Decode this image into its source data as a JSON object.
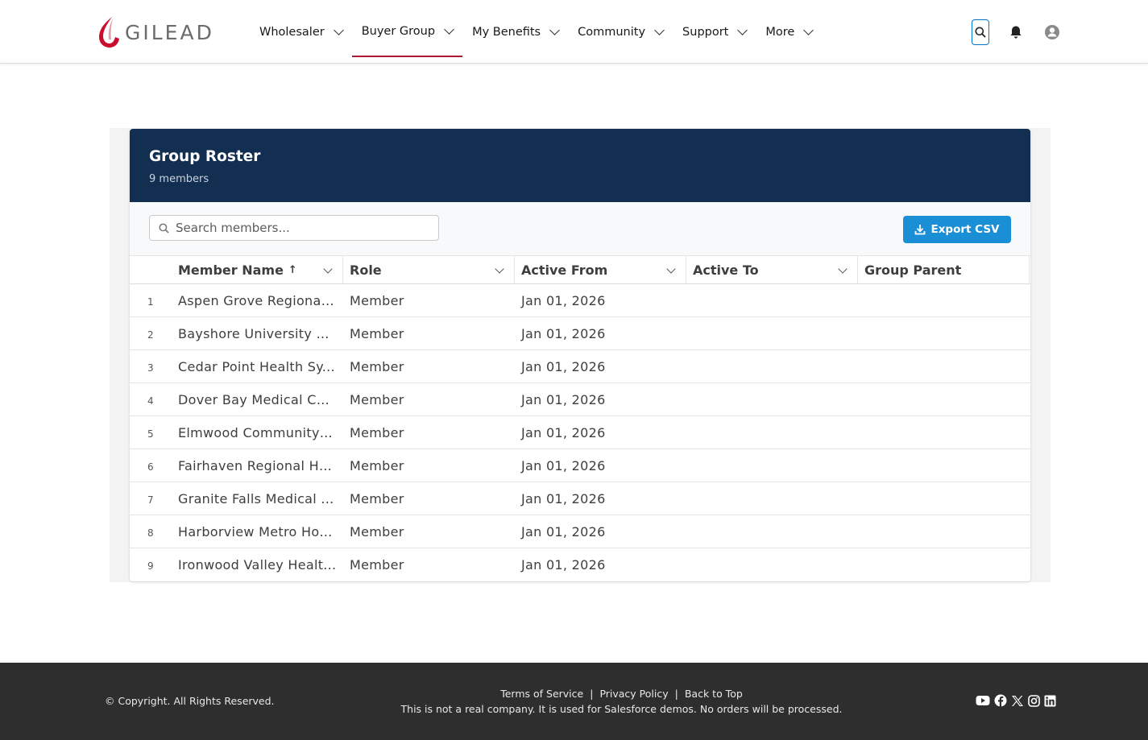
{
  "brand": {
    "name": "GILEAD",
    "accent": "#b0162d"
  },
  "nav": {
    "items": [
      {
        "label": "Wholesaler"
      },
      {
        "label": "Buyer Group"
      },
      {
        "label": "My Benefits"
      },
      {
        "label": "Community"
      },
      {
        "label": "Support"
      },
      {
        "label": "More"
      }
    ],
    "active": "Buyer Group"
  },
  "header_icons": [
    "search-icon",
    "bell-icon",
    "user-avatar-icon"
  ],
  "roster": {
    "title": "Group Roster",
    "subtitle": "9 members",
    "search_placeholder": "Search members...",
    "export_label": "Export CSV",
    "columns": {
      "name": "Member Name",
      "name_sort": "↑",
      "role": "Role",
      "from": "Active From",
      "to": "Active To",
      "parent": "Group Parent"
    },
    "rows": [
      {
        "n": "1",
        "name": "Aspen Grove Regional...",
        "role": "Member",
        "from": "Jan 01, 2026",
        "to": "",
        "parent": ""
      },
      {
        "n": "2",
        "name": "Bayshore University H...",
        "role": "Member",
        "from": "Jan 01, 2026",
        "to": "",
        "parent": ""
      },
      {
        "n": "3",
        "name": "Cedar Point Health Sy...",
        "role": "Member",
        "from": "Jan 01, 2026",
        "to": "",
        "parent": ""
      },
      {
        "n": "4",
        "name": "Dover Bay Medical Ce...",
        "role": "Member",
        "from": "Jan 01, 2026",
        "to": "",
        "parent": ""
      },
      {
        "n": "5",
        "name": "Elmwood Community ...",
        "role": "Member",
        "from": "Jan 01, 2026",
        "to": "",
        "parent": ""
      },
      {
        "n": "6",
        "name": "Fairhaven Regional He...",
        "role": "Member",
        "from": "Jan 01, 2026",
        "to": "",
        "parent": ""
      },
      {
        "n": "7",
        "name": "Granite Falls Medical ...",
        "role": "Member",
        "from": "Jan 01, 2026",
        "to": "",
        "parent": ""
      },
      {
        "n": "8",
        "name": "Harborview Metro Hos...",
        "role": "Member",
        "from": "Jan 01, 2026",
        "to": "",
        "parent": ""
      },
      {
        "n": "9",
        "name": "Ironwood Valley Healt...",
        "role": "Member",
        "from": "Jan 01, 2026",
        "to": "",
        "parent": ""
      }
    ]
  },
  "footer": {
    "copyright": "© Copyright. All Rights Reserved.",
    "links": [
      "Terms of Service",
      "Privacy Policy",
      "Back to Top"
    ],
    "separator": "|",
    "note": "This is not a real company. It is used for Salesforce demos. No orders will be processed.",
    "social": [
      "youtube-icon",
      "facebook-icon",
      "x-icon",
      "instagram-icon",
      "linkedin-icon"
    ]
  }
}
